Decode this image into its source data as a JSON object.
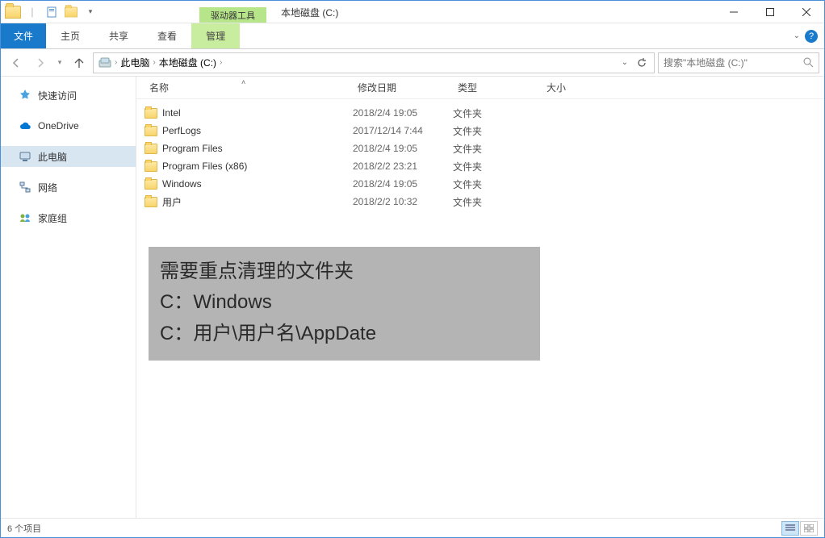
{
  "titlebar": {
    "context_tab": "驱动器工具",
    "title": "本地磁盘 (C:)"
  },
  "ribbon": {
    "file": "文件",
    "tabs": [
      "主页",
      "共享",
      "查看"
    ],
    "context": "管理"
  },
  "nav": {
    "crumbs": [
      "此电脑",
      "本地磁盘 (C:)"
    ],
    "search_placeholder": "搜索\"本地磁盘 (C:)\""
  },
  "sidebar": {
    "items": [
      {
        "label": "快速访问",
        "icon": "star",
        "color": "#4aa3df"
      },
      {
        "label": "OneDrive",
        "icon": "cloud",
        "color": "#0078d4"
      },
      {
        "label": "此电脑",
        "icon": "pc",
        "color": "#5a7a99",
        "selected": true
      },
      {
        "label": "网络",
        "icon": "net",
        "color": "#5a7a99"
      },
      {
        "label": "家庭组",
        "icon": "home",
        "color": "#7cb342"
      }
    ]
  },
  "columns": {
    "name": "名称",
    "date": "修改日期",
    "type": "类型",
    "size": "大小"
  },
  "files": [
    {
      "name": "Intel",
      "date": "2018/2/4 19:05",
      "type": "文件夹"
    },
    {
      "name": "PerfLogs",
      "date": "2017/12/14 7:44",
      "type": "文件夹"
    },
    {
      "name": "Program Files",
      "date": "2018/2/4 19:05",
      "type": "文件夹"
    },
    {
      "name": "Program Files (x86)",
      "date": "2018/2/2 23:21",
      "type": "文件夹"
    },
    {
      "name": "Windows",
      "date": "2018/2/4 19:05",
      "type": "文件夹"
    },
    {
      "name": "用户",
      "date": "2018/2/2 10:32",
      "type": "文件夹"
    }
  ],
  "annotation": {
    "line1": "需要重点清理的文件夹",
    "line2": "C：Windows",
    "line3": "C：用户\\用户名\\AppDate"
  },
  "status": {
    "count": "6 个项目"
  }
}
